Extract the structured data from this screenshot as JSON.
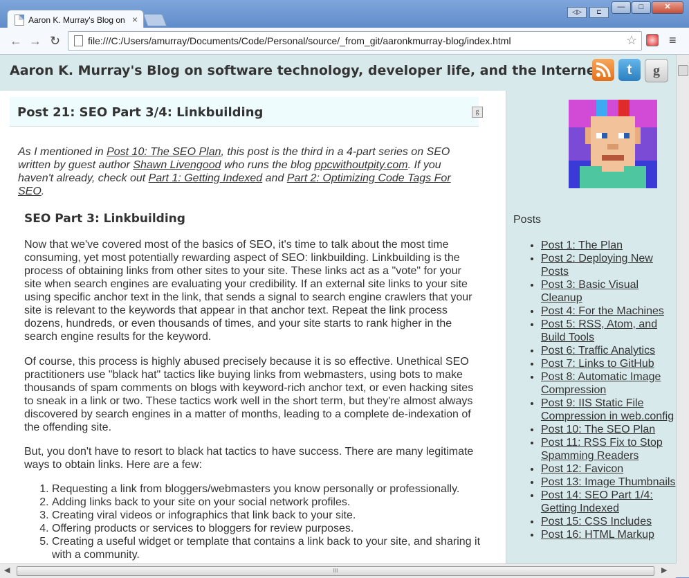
{
  "browser": {
    "tab_title": "Aaron K. Murray's Blog on",
    "tab_close": "×",
    "url": "file:///C:/Users/amurray/Documents/Code/Personal/source/_from_git/aaronkmurray-blog/index.html",
    "back": "←",
    "forward": "→",
    "reload": "↻",
    "star": "☆",
    "menu": "≡",
    "window": {
      "minimize": "—",
      "maximize": "□",
      "close": "✕"
    }
  },
  "header": {
    "title": "Aaron K. Murray's Blog on software technology, developer life, and the Internet.",
    "icons": [
      "rss-icon",
      "twitter-icon",
      "github-icon"
    ],
    "twitter_glyph": "t",
    "github_glyph": "g"
  },
  "post": {
    "title": "Post 21: SEO Part 3/4: Linkbuilding",
    "gh_glyph": "g",
    "intro": {
      "t1": "As I mentioned in ",
      "link1": "Post 10: The SEO Plan",
      "t2": ", this post is the third in a 4-part series on SEO written by guest author ",
      "link2": "Shawn Livengood",
      "t3": " who runs the blog ",
      "link3": "ppcwithoutpity.com",
      "t4": ". If you haven't already, check out ",
      "link4": "Part 1: Getting Indexed",
      "t5": " and ",
      "link5": "Part 2: Optimizing Code Tags For SEO",
      "t6": "."
    },
    "section_heading": "SEO Part 3: Linkbuilding",
    "paragraphs": [
      "Now that we've covered most of the basics of SEO, it's time to talk about the most time consuming, yet most potentially rewarding aspect of SEO: linkbuilding. Linkbuilding is the process of obtaining links from other sites to your site. These links act as a \"vote\" for your site when search engines are evaluating your credibility. If an external site links to your site using specific anchor text in the link, that sends a signal to search engine crawlers that your site is relevant to the keywords that appear in that anchor text. Repeat the link process dozens, hundreds, or even thousands of times, and your site starts to rank higher in the search engine results for the keyword.",
      "Of course, this process is highly abused precisely because it is so effective. Unethical SEO practitioners use \"black hat\" tactics like buying links from webmasters, using bots to make thousands of spam comments on blogs with keyword-rich anchor text, or even hacking sites to sneak in a link or two. These tactics work well in the short term, but they're almost always discovered by search engines in a matter of months, leading to a complete de-indexation of the offending site.",
      "But, you don't have to resort to black hat tactics to have success. There are many legitimate ways to obtain links. Here are a few:"
    ],
    "ways": [
      "Requesting a link from bloggers/webmasters you know personally or professionally.",
      "Adding links back to your site on your social network profiles.",
      "Creating viral videos or infographics that link back to your site.",
      "Offering products or services to bloggers for review purposes.",
      "Creating a useful widget or template that contains a link back to your site, and sharing it with a community."
    ]
  },
  "sidebar": {
    "posts_heading": "Posts",
    "posts": [
      "Post 1: The Plan",
      "Post 2: Deploying New Posts",
      "Post 3: Basic Visual Cleanup",
      "Post 4: For the Machines",
      "Post 5: RSS, Atom, and Build Tools",
      "Post 6: Traffic Analytics",
      "Post 7: Links to GitHub",
      "Post 8: Automatic Image Compression",
      "Post 9: IIS Static File Compression in web.config",
      "Post 10: The SEO Plan",
      "Post 11: RSS Fix to Stop Spamming Readers",
      "Post 12: Favicon",
      "Post 13: Image Thumbnails",
      "Post 14: SEO Part 1/4: Getting Indexed",
      "Post 15: CSS Includes",
      "Post 16: HTML Markup"
    ]
  },
  "scroll": {
    "hthumb_glyph": "III"
  }
}
